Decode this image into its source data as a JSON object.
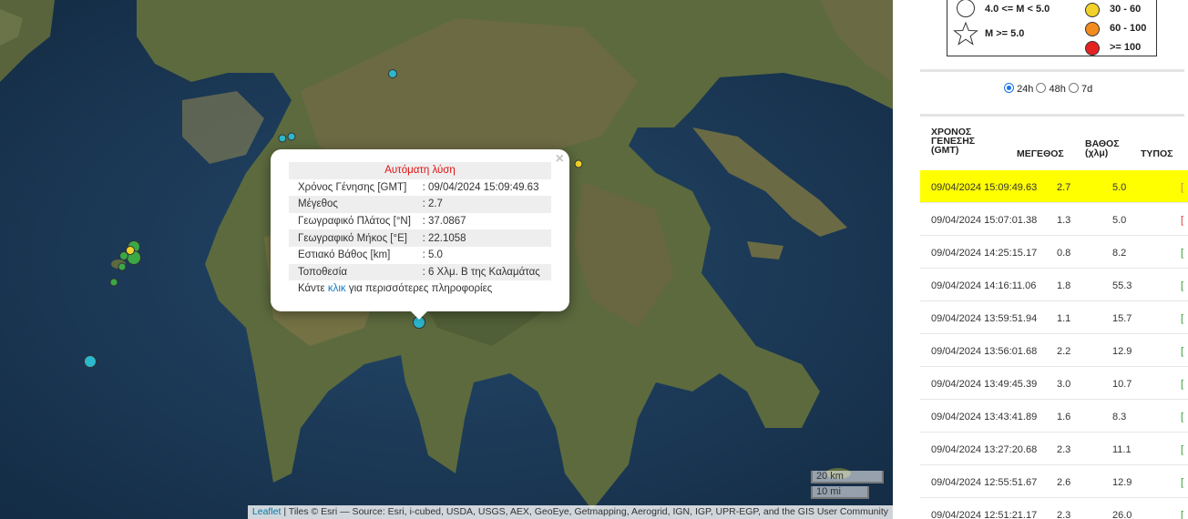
{
  "map": {
    "popup": {
      "header": "Αυτόματη λύση",
      "close": "×",
      "rows": [
        {
          "label": "Χρόνος Γένησης [GMT]",
          "value": ": 09/04/2024 15:09:49.63"
        },
        {
          "label": "Μέγεθος",
          "value": ": 2.7"
        },
        {
          "label": "Γεωγραφικό Πλάτος [°N]",
          "value": ": 37.0867"
        },
        {
          "label": "Γεωγραφικό Μήκος [°E]",
          "value": ": 22.1058"
        },
        {
          "label": "Εστιακό Βάθος [km]",
          "value": ": 5.0"
        },
        {
          "label": "Τοποθεσία",
          "value": ": 6 Χλμ. Β της Καλαμάτας"
        }
      ],
      "more_prefix": "Κάντε",
      "more_link": "κλικ",
      "more_suffix": "για περισσότερες πληροφορίες"
    },
    "scale_km": "20 km",
    "scale_mi": "10 mi",
    "attribution_link": "Leaflet",
    "attribution_text": " | Tiles © Esri — Source: Esri, i-cubed, USDA, USGS, AEX, GeoEye, Getmapping, Aerogrid, IGN, IGP, UPR-EGP, and the GIS User Community",
    "colors": {
      "cyan": "#2bb7cc",
      "green": "#3aa845",
      "yellow": "#f2d22a",
      "orange": "#f28c1e",
      "red": "#e42222"
    }
  },
  "legend": {
    "mag_1": "4.0 <= M < 5.0",
    "mag_2": "M >= 5.0",
    "depth_1": "30 - 60",
    "depth_2": "60 - 100",
    "depth_3": ">= 100",
    "star_icon": "star-icon"
  },
  "filters": [
    {
      "label": "24h",
      "selected": true
    },
    {
      "label": "48h",
      "selected": false
    },
    {
      "label": "7d",
      "selected": false
    }
  ],
  "table": {
    "headers": {
      "origin": [
        "ΧΡΟΝΟΣ",
        "ΓΕΝΕΣΗΣ",
        "(GMT)"
      ],
      "magnitude": "ΜΕΓΕΘΟΣ",
      "depth": [
        "ΒΑΘΟΣ",
        "(χλμ)"
      ],
      "type": "ΤΥΠΟΣ"
    },
    "rows": [
      {
        "time": "09/04/2024 15:09:49.63",
        "mag": "2.7",
        "depth": "5.0",
        "type": "[",
        "selected": true
      },
      {
        "time": "09/04/2024 15:07:01.38",
        "mag": "1.3",
        "depth": "5.0",
        "type": "["
      },
      {
        "time": "09/04/2024 14:25:15.17",
        "mag": "0.8",
        "depth": "8.2",
        "type": "["
      },
      {
        "time": "09/04/2024 14:16:11.06",
        "mag": "1.8",
        "depth": "55.3",
        "type": "["
      },
      {
        "time": "09/04/2024 13:59:51.94",
        "mag": "1.1",
        "depth": "15.7",
        "type": "["
      },
      {
        "time": "09/04/2024 13:56:01.68",
        "mag": "2.2",
        "depth": "12.9",
        "type": "["
      },
      {
        "time": "09/04/2024 13:49:45.39",
        "mag": "3.0",
        "depth": "10.7",
        "type": "["
      },
      {
        "time": "09/04/2024 13:43:41.89",
        "mag": "1.6",
        "depth": "8.3",
        "type": "["
      },
      {
        "time": "09/04/2024 13:27:20.68",
        "mag": "2.3",
        "depth": "11.1",
        "type": "["
      },
      {
        "time": "09/04/2024 12:55:51.67",
        "mag": "2.6",
        "depth": "12.9",
        "type": "["
      },
      {
        "time": "09/04/2024 12:51:21.17",
        "mag": "2.3",
        "depth": "26.0",
        "type": "["
      }
    ]
  }
}
